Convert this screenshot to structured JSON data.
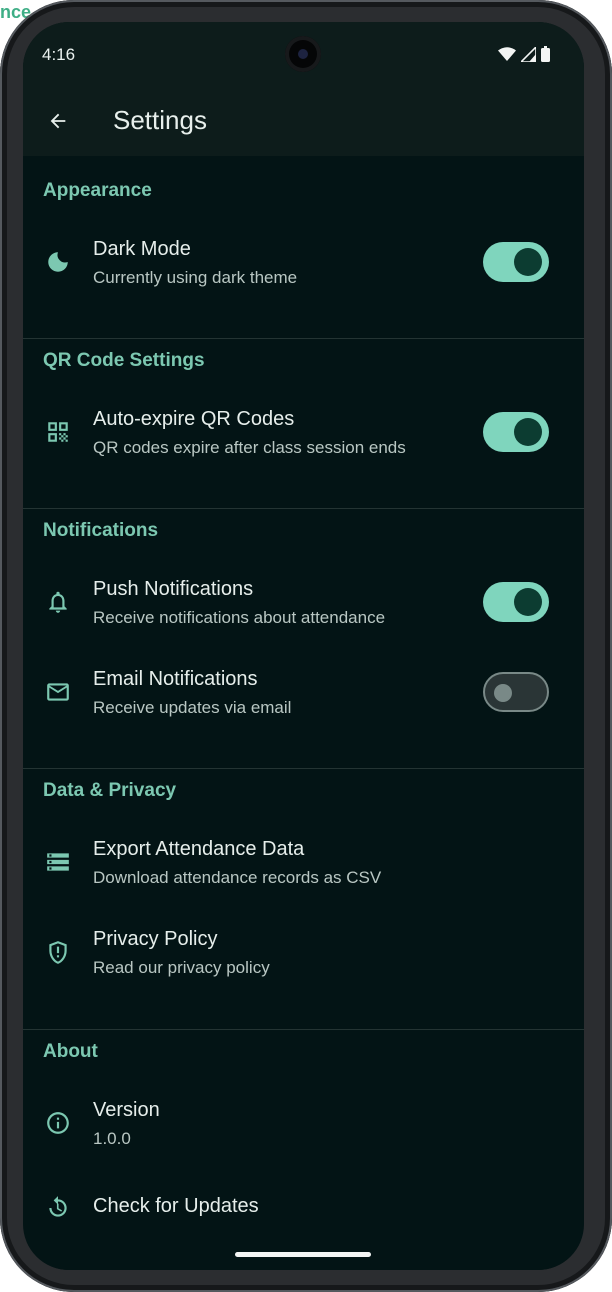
{
  "background": {
    "corner_text": "nce"
  },
  "status_bar": {
    "time": "4:16"
  },
  "app_bar": {
    "title": "Settings"
  },
  "sections": {
    "appearance": {
      "header": "Appearance",
      "dark_mode": {
        "title": "Dark Mode",
        "subtitle": "Currently using dark theme",
        "enabled": true,
        "icon": "moon-icon"
      }
    },
    "qr": {
      "header": "QR Code Settings",
      "auto_expire": {
        "title": "Auto-expire QR Codes",
        "subtitle": "QR codes expire after class session ends",
        "enabled": true,
        "icon": "qr-code-icon"
      }
    },
    "notifications": {
      "header": "Notifications",
      "push": {
        "title": "Push Notifications",
        "subtitle": "Receive notifications about attendance",
        "enabled": true,
        "icon": "bell-icon"
      },
      "email": {
        "title": "Email Notifications",
        "subtitle": "Receive updates via email",
        "enabled": false,
        "icon": "mail-icon"
      }
    },
    "privacy": {
      "header": "Data & Privacy",
      "export": {
        "title": "Export Attendance Data",
        "subtitle": "Download attendance records as CSV",
        "icon": "storage-icon"
      },
      "policy": {
        "title": "Privacy Policy",
        "subtitle": "Read our privacy policy",
        "icon": "shield-icon"
      }
    },
    "about": {
      "header": "About",
      "version": {
        "title": "Version",
        "subtitle": "1.0.0",
        "icon": "info-icon"
      },
      "updates": {
        "title": "Check for Updates",
        "icon": "refresh-icon"
      }
    }
  },
  "colors": {
    "screen_bg": "#031415",
    "app_bar_bg": "#0d1c1b",
    "accent": "#7cc8b1",
    "toggle_on": "#7fd5bd",
    "toggle_knob_on": "#0c3c31",
    "toggle_off_border": "#798987"
  }
}
